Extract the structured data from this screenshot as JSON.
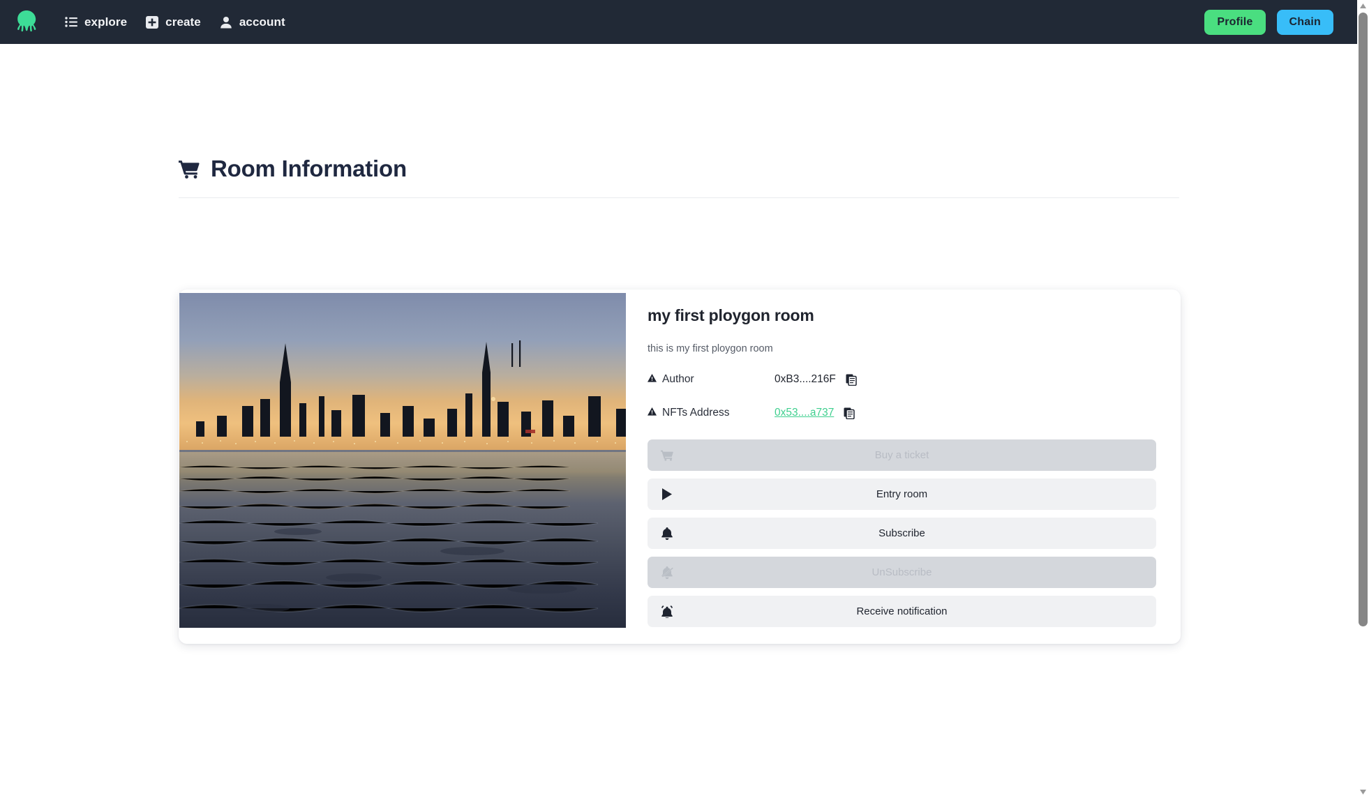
{
  "navbar": {
    "logo": "octopus-logo",
    "links": [
      {
        "label": "explore",
        "icon": "list-icon"
      },
      {
        "label": "create",
        "icon": "plus-square-icon"
      },
      {
        "label": "account",
        "icon": "user-icon"
      }
    ],
    "profile_label": "Profile",
    "chain_label": "Chain",
    "profile_color": "#4ade80",
    "chain_color": "#38bdf8",
    "background_color": "#212936"
  },
  "header": {
    "title": "Room Information",
    "icon": "shopping-cart-icon"
  },
  "room": {
    "title": "my first ploygon room",
    "description": "this is my first ploygon room",
    "image_alt": "city skyline at sunset over water",
    "fields": [
      {
        "label": "Author",
        "icon": "warning-triangle-icon",
        "value": "0xB3....216F",
        "is_link": false,
        "copy_icon": "copy-icon"
      },
      {
        "label": "NFTs Address",
        "icon": "warning-triangle-icon",
        "value": "0x53....a737",
        "is_link": true,
        "link_color": "#3ecf8e",
        "copy_icon": "copy-icon"
      }
    ],
    "actions": [
      {
        "label": "Buy a ticket",
        "icon": "cart-icon",
        "disabled": true
      },
      {
        "label": "Entry room",
        "icon": "play-icon",
        "disabled": false
      },
      {
        "label": "Subscribe",
        "icon": "bell-icon",
        "disabled": false
      },
      {
        "label": "UnSubscribe",
        "icon": "bell-slash-icon",
        "disabled": true
      },
      {
        "label": "Receive notification",
        "icon": "bell-ring-icon",
        "disabled": false
      }
    ]
  }
}
